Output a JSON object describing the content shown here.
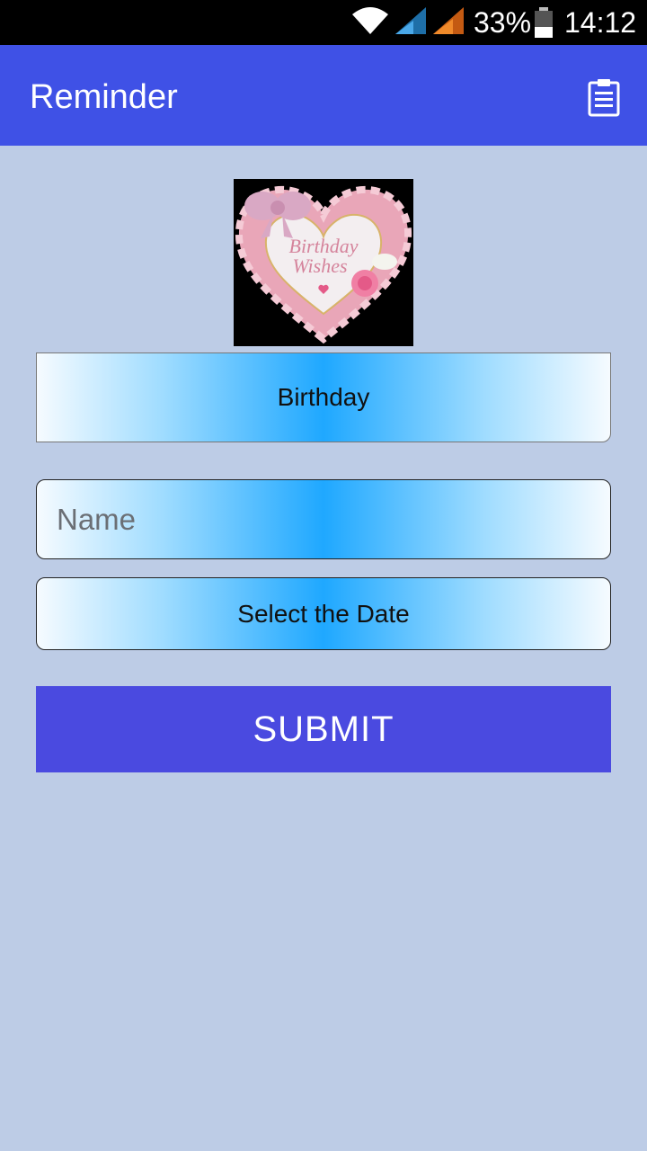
{
  "status_bar": {
    "battery_percent": "33%",
    "time": "14:12",
    "icons": [
      "wifi-icon",
      "signal-icon",
      "signal-icon",
      "battery-icon"
    ]
  },
  "app_bar": {
    "title": "Reminder",
    "action_icon": "clipboard-icon",
    "color": "#3f51e6"
  },
  "hero_image": {
    "lettering": "Birthday Wishes"
  },
  "form": {
    "category_label": "Birthday",
    "name_placeholder": "Name",
    "name_value": "",
    "date_label": "Select the Date",
    "submit_label": "SUBMIT"
  },
  "colors": {
    "background": "#bdcce6",
    "submit": "#4a4ae0",
    "gradient_center": "#1fa8ff"
  }
}
